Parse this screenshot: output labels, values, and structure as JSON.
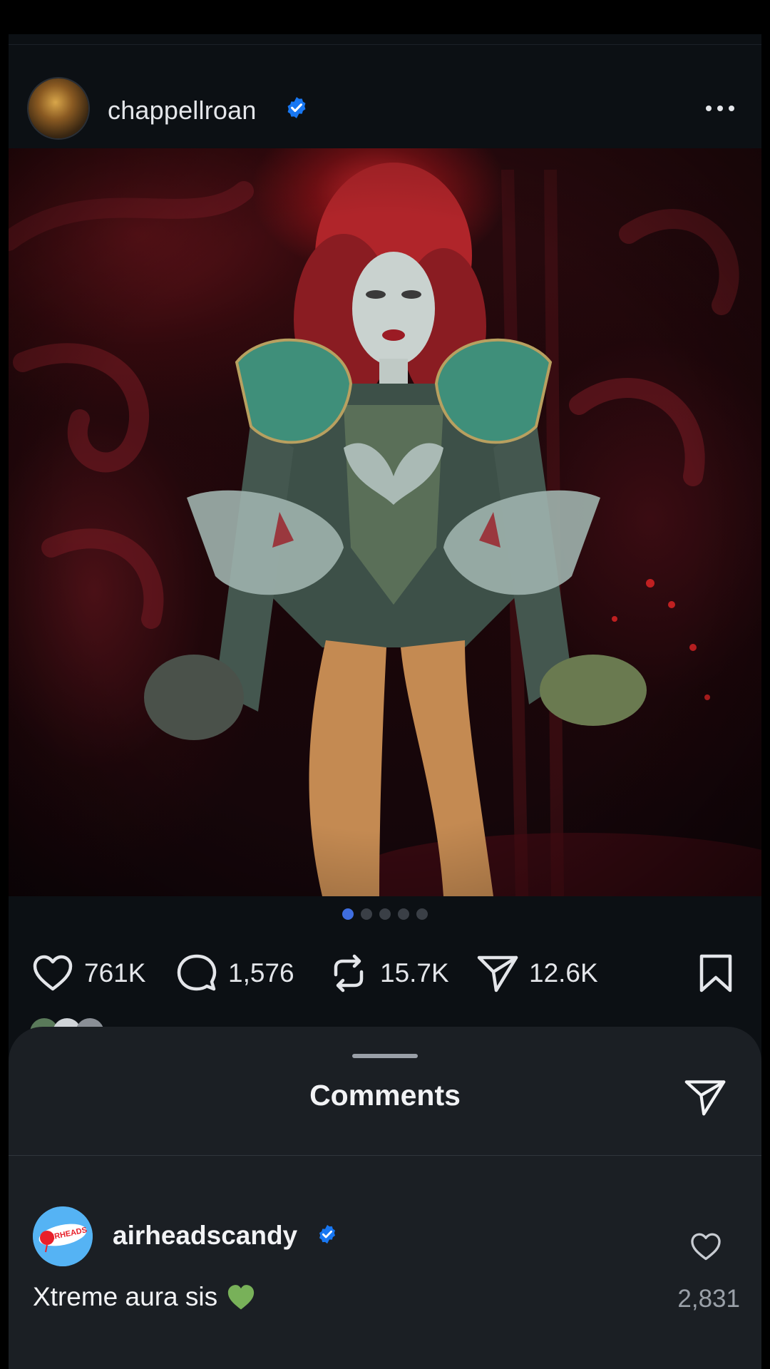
{
  "post": {
    "username": "chappellroan",
    "verified": true,
    "more_icon": "more-horizontal-icon",
    "carousel": {
      "count": 5,
      "active_index": 0
    }
  },
  "actions": {
    "likes": "761K",
    "comments": "1,576",
    "reposts": "15.7K",
    "shares": "12.6K"
  },
  "comments_sheet": {
    "title": "Comments",
    "items": [
      {
        "username": "airheadscandy",
        "verified": true,
        "avatar_text": "AIRHEADS",
        "text": "Xtreme aura sis",
        "emoji": "green-heart",
        "like_count": "2,831"
      }
    ]
  },
  "colors": {
    "background": "#0c1014",
    "sheet": "#1b1f24",
    "verified_blue": "#1877f2",
    "active_dot": "#3f6ee0",
    "emoji_green": "#78b159"
  }
}
